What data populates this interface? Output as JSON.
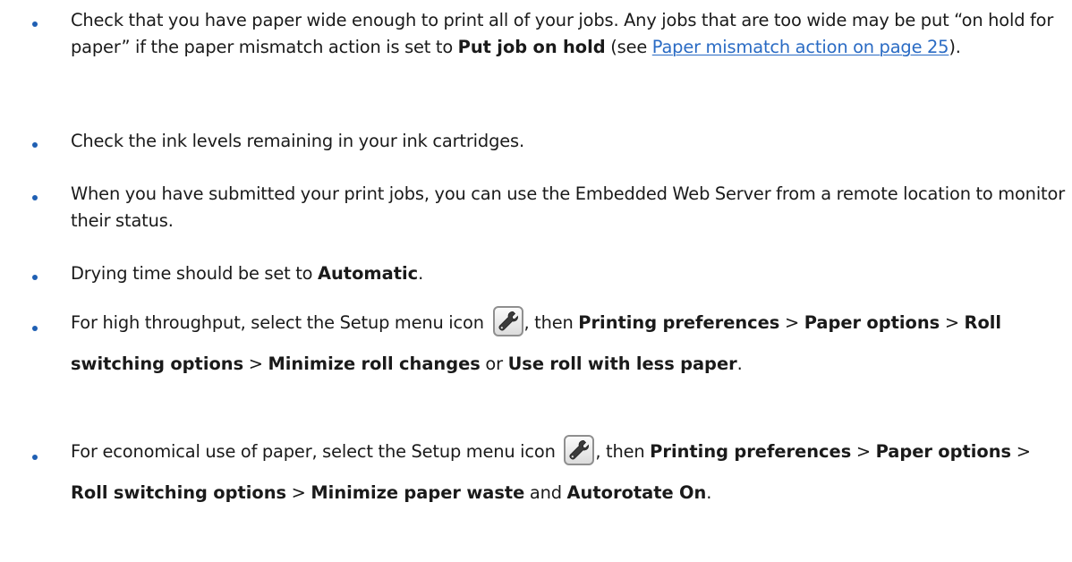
{
  "bullets": [
    {
      "segments": [
        {
          "t": "Check that you have paper wide enough to print all of your jobs. Any jobs that are too wide may be put “on hold for paper” if the paper mismatch action is set to "
        },
        {
          "b": "Put job on hold"
        },
        {
          "t": " (see "
        },
        {
          "link": "Paper mismatch action on page 25"
        },
        {
          "t": ")."
        }
      ]
    },
    {
      "segments": [
        {
          "t": "Check the ink levels remaining in your ink cartridges."
        }
      ]
    },
    {
      "segments": [
        {
          "t": "When you have submitted your print jobs, you can use the Embedded Web Server from a remote location to monitor their status."
        }
      ]
    },
    {
      "segments": [
        {
          "t": "Drying time should be set to "
        },
        {
          "b": "Automatic"
        },
        {
          "t": "."
        }
      ]
    },
    {
      "segments": [
        {
          "t": "For high throughput, select the Setup menu icon "
        },
        {
          "icon": "setup-menu-wrench-icon"
        },
        {
          "t": ", then "
        },
        {
          "b": "Printing preferences"
        },
        {
          "t": " > "
        },
        {
          "b": "Paper options"
        },
        {
          "t": " > "
        },
        {
          "b": "Roll switching options"
        },
        {
          "t": " > "
        },
        {
          "b": "Minimize roll changes"
        },
        {
          "t": " or "
        },
        {
          "b": "Use roll with less paper"
        },
        {
          "t": "."
        }
      ]
    },
    {
      "segments": [
        {
          "t": "For economical use of paper, select the Setup menu icon "
        },
        {
          "icon": "setup-menu-wrench-icon"
        },
        {
          "t": ", then "
        },
        {
          "b": "Printing preferences"
        },
        {
          "t": " > "
        },
        {
          "b": "Paper options"
        },
        {
          "t": " > "
        },
        {
          "b": "Roll switching options"
        },
        {
          "t": " > "
        },
        {
          "b": "Minimize paper waste"
        },
        {
          "t": " and "
        },
        {
          "b": "Autorotate On"
        },
        {
          "t": "."
        }
      ]
    }
  ],
  "colors": {
    "bullet": "#1f5fb3",
    "link": "#2a6bc4",
    "text": "#1a1a1a"
  }
}
